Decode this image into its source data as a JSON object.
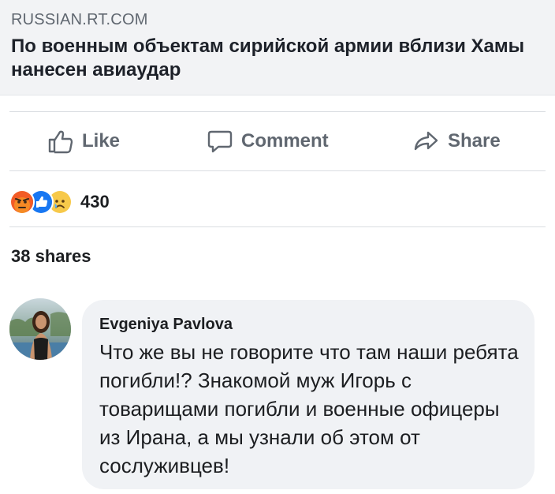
{
  "link_preview": {
    "domain": "RUSSIAN.RT.COM",
    "title": "По военным объектам сирийской армии вблизи Хамы нанесен авиаудар"
  },
  "actions": {
    "like_label": "Like",
    "comment_label": "Comment",
    "share_label": "Share"
  },
  "reactions": {
    "icons": [
      "angry-reaction-icon",
      "like-reaction-icon",
      "sad-reaction-icon"
    ],
    "count": "430"
  },
  "shares": {
    "text": "38 shares"
  },
  "comment": {
    "author": "Evgeniya Pavlova",
    "text": "Что же вы не говорите что там наши ребята погибли!? Знакомой муж Игорь с товарищами погибли и военные офицеры из Ирана, а мы узнали об этом от сослуживцев!"
  },
  "colors": {
    "muted_text": "#606770",
    "card_background": "#f2f3f5",
    "bubble_background": "#f0f2f5",
    "like_blue": "#1877f2",
    "angry_orange": "#f25c27",
    "sad_yellow": "#f7c94a"
  }
}
